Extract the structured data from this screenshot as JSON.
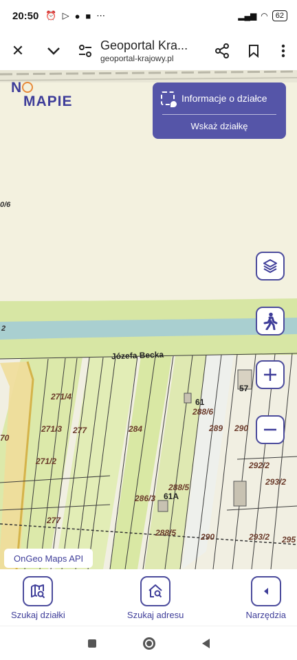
{
  "status_bar": {
    "time": "20:50",
    "left_icons": [
      "alarm-icon",
      "play-icon",
      "facebook-icon",
      "briefcase-icon",
      "more-icon"
    ],
    "battery": "62"
  },
  "browser": {
    "title": "Geoportal Kra...",
    "url": "geoportal-krajowy.pl"
  },
  "map": {
    "logo_line1": "NO",
    "logo_line2": "MAPIE",
    "info_panel": {
      "title": "Informacje o działce",
      "action": "Wskaż działkę"
    },
    "street_label": "Józefa Becka",
    "parcel_labels": [
      "0/6",
      "2",
      "271/4",
      "271/3",
      "277",
      "284",
      "61",
      "288/6",
      "57",
      "289",
      "290",
      "70",
      "271/2",
      "292/2",
      "293/2",
      "288/5",
      "286/3",
      "61A",
      "277",
      "288/5",
      "290",
      "293/2",
      "295"
    ],
    "api_label": "OnGeo Maps API",
    "colors": {
      "accent": "#4b4b9c",
      "field": "#f3f1df",
      "parcel_green": "#d9e8a4",
      "river": "#a9cfd0"
    }
  },
  "bottom_nav": {
    "items": [
      {
        "label": "Szukaj działki",
        "icon": "map-search-icon"
      },
      {
        "label": "Szukaj adresu",
        "icon": "home-search-icon"
      },
      {
        "label": "Narzędzia",
        "icon": "chevron-left-icon"
      }
    ]
  }
}
